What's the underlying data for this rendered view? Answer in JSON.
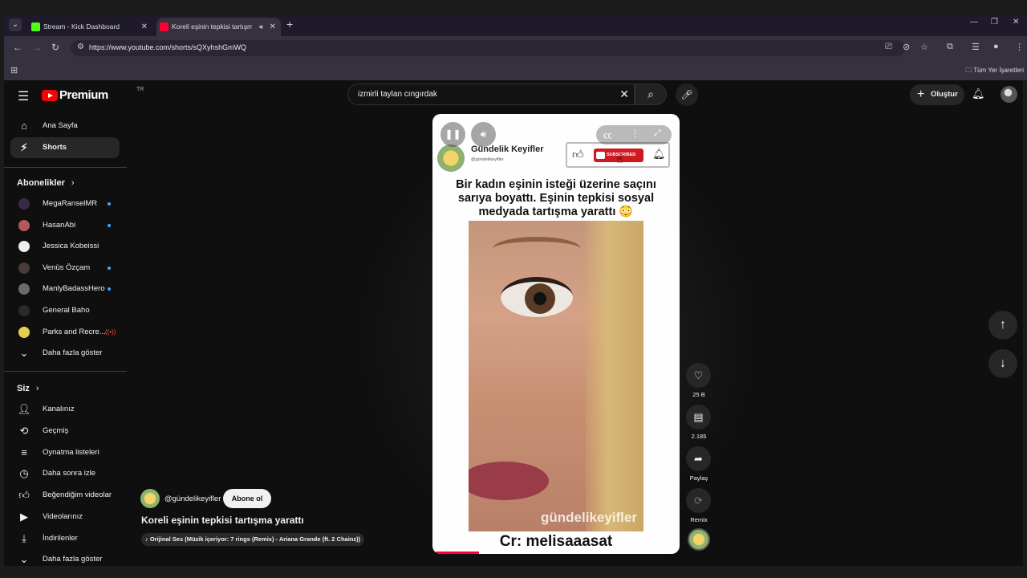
{
  "browser": {
    "tabs": [
      {
        "title": "Stream - Kick Dashboard",
        "favicon_color": "#53fc18"
      },
      {
        "title": "Koreli eşinin tepkisi tartışm",
        "favicon_color": "#ff0033"
      }
    ],
    "url": "https://www.youtube.com/shorts/sQXyhshGmWQ",
    "bookmarks_all": "Tüm Yer İşaretleri"
  },
  "header": {
    "logo_text": "Premium",
    "country_code": "TR",
    "search_query": "izmirli taylan cıngırdak",
    "create_label": "Oluştur"
  },
  "sidebar": {
    "main": [
      {
        "label": "Ana Sayfa",
        "icon": "home-icon"
      },
      {
        "label": "Shorts",
        "icon": "shorts-icon",
        "active": true
      }
    ],
    "subscriptions_heading": "Abonelikler",
    "subscriptions": [
      {
        "label": "MegaRanselMR",
        "indicator": "dot",
        "avatar_color": "#3a2a4a"
      },
      {
        "label": "HasanAbi",
        "indicator": "dot",
        "avatar_color": "#b05a5a"
      },
      {
        "label": "Jessica Kobeissi",
        "indicator": "",
        "avatar_color": "#eeeeee"
      },
      {
        "label": "Venüs Özçam",
        "indicator": "dot",
        "avatar_color": "#4a3a3a"
      },
      {
        "label": "ManlyBadassHero",
        "indicator": "dot",
        "avatar_color": "#6a6a6a"
      },
      {
        "label": "General Baho",
        "indicator": "",
        "avatar_color": "#2a2a2a"
      },
      {
        "label": "Parks and Recre...",
        "indicator": "live",
        "avatar_color": "#e8d14a"
      }
    ],
    "show_more_1": "Daha fazla göster",
    "you_heading": "Siz",
    "you_items": [
      {
        "label": "Kanalınız",
        "icon": "channel-icon"
      },
      {
        "label": "Geçmiş",
        "icon": "history-icon"
      },
      {
        "label": "Oynatma listeleri",
        "icon": "playlists-icon"
      },
      {
        "label": "Daha sonra izle",
        "icon": "watch-later-icon"
      },
      {
        "label": "Beğendiğim videolar",
        "icon": "liked-icon"
      },
      {
        "label": "Videolarınız",
        "icon": "your-videos-icon"
      },
      {
        "label": "İndirilenler",
        "icon": "downloads-icon"
      }
    ],
    "show_more_2": "Daha fazla göster"
  },
  "video": {
    "channel_name": "Gündelik Keyifler",
    "channel_handle": "@gündelikeyifler",
    "subscribed_badge": "SUBSCRIBED",
    "headline": "Bir kadın eşinin isteği üzerine saçını sarıya boyattı. Eşinin tepkisi sosyal medyada tartışma yarattı 😳",
    "watermark": "gündelikeyifler",
    "credit": "Cr: melisaaasat",
    "overlay_handle": "@gündelikeyifler",
    "subscribe_label": "Abone ol",
    "title": "Koreli eşinin tepkisi tartışma yarattı",
    "music": "Orijinal Ses (Müzik içeriyor: 7 rings (Remix) - Ariana Grande (ft. 2 Chainz))",
    "progress": 0.18
  },
  "actions": {
    "likes": "25 B",
    "comments": "2.185",
    "share": "Paylaş",
    "remix": "Remix"
  }
}
